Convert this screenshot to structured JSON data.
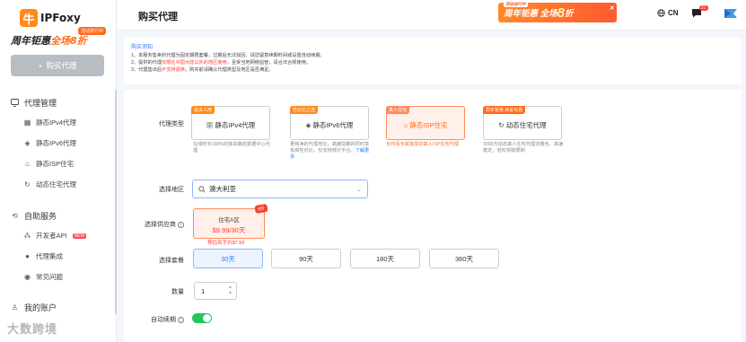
{
  "sidebar": {
    "logo_mark": "牛",
    "logo_text": "IPFoxy",
    "promo": {
      "main_a": "周年钜惠",
      "main_b": "全场8折",
      "tag": "活动进行中"
    },
    "buy_button": "购买代理",
    "groups": [
      {
        "label": "代理管理",
        "icon": "proxy-manage-icon",
        "items": [
          {
            "label": "静态IPv4代理",
            "icon": "grid-icon"
          },
          {
            "label": "静态IPv6代理",
            "icon": "layers-icon"
          },
          {
            "label": "静态ISP住宅",
            "icon": "home-icon"
          },
          {
            "label": "动态住宅代理",
            "icon": "refresh-icon"
          }
        ]
      },
      {
        "label": "自助服务",
        "icon": "self-service-icon",
        "items": [
          {
            "label": "开发者API",
            "icon": "api-icon",
            "badge": "NEW"
          },
          {
            "label": "代理集成",
            "icon": "integration-icon"
          },
          {
            "label": "常见问题",
            "icon": "question-icon"
          }
        ]
      },
      {
        "label": "我的账户",
        "icon": "user-icon",
        "items": []
      }
    ],
    "watermark": "大数跨境"
  },
  "header": {
    "title": "购买代理",
    "banner": {
      "tag": "活动进行中",
      "text": "周年钜惠 全场",
      "big": "8",
      "tail": "折"
    },
    "lang": "CN",
    "msg_count": "21"
  },
  "notice": {
    "title": "购买须知",
    "lines": [
      "1、本服务售卖的代理为固定期限套餐，过期后无法找回，请您留意续期时间或设置自动续期。",
      "2、提供的代理仅限在中国大陆以外的地区使用，且受当地网络监管，请合法合规使用。",
      "3、代理售出后不支持退换，购买前请确认代理类型及地区是否满足。"
    ],
    "line2_red": "仅限在中国大陆以外的地区使用",
    "line3_red": "不支持退换"
  },
  "form": {
    "type_label": "代理类型",
    "types": [
      {
        "tag": "最多人用",
        "tag_color": "#ff8a1c",
        "title": "静态IPv4代理",
        "icon": "grid-icon",
        "desc": "在线时长100%的独享静态数据中心代理"
      },
      {
        "tag": "性价比之选",
        "tag_color": "#ff8a1c",
        "title": "静态IPv6代理",
        "icon": "layers-icon",
        "desc": "更纯净的代理地址，高度隐蔽的同时享有高性价比，仅支持部分平台。",
        "link": "了解更多"
      },
      {
        "tag": "真人住宅",
        "tag_color": "#ff8a5c",
        "title": "静态ISP住宅",
        "icon": "home-icon",
        "desc": "长时间专属独享的真人ISP住宅代理"
      },
      {
        "tag": "周年钜惠 新星有惠",
        "tag_color": "#ff6b1a",
        "title": "动态住宅代理",
        "icon": "refresh-icon",
        "desc": "3000万动态真人住宅代理流量包，高速稳定，轻松突破限制"
      }
    ],
    "region_label": "选择地区",
    "region_value": "澳大利亚",
    "supplier_label": "选择供应商",
    "supplier": {
      "name": "住宅A区",
      "price": "$9.99/30天",
      "ribbon": "8折",
      "original": "预估到手价$7.99"
    },
    "plan_label": "选择套餐",
    "plans": [
      "30天",
      "90天",
      "180天",
      "360天"
    ],
    "qty_label": "数量",
    "qty_value": "1",
    "renew_label": "自动续期",
    "renew_on": true
  },
  "colors": {
    "accent": "#2b7cff",
    "orange": "#ff6b1a",
    "green": "#22c55e"
  }
}
